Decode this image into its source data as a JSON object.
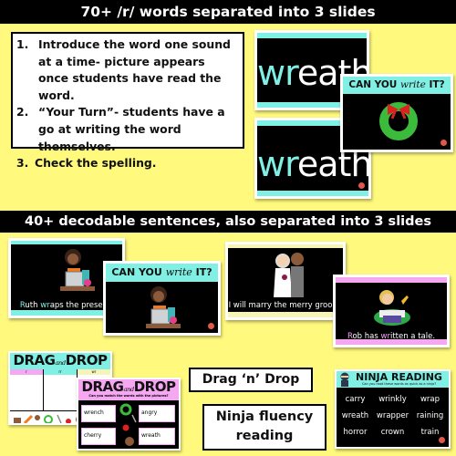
{
  "banners": {
    "top": "70+ /r/ words separated into 3 slides",
    "middle": "40+ decodable sentences, also separated into 3 slides"
  },
  "instructions": [
    {
      "num": "1.",
      "text": "Introduce the word one sound at a time- picture appears once students have read the word."
    },
    {
      "num": "2.",
      "text": "“Your Turn”- students have a go at writing the word themselves."
    },
    {
      "num": "3.",
      "text": "Check the spelling."
    }
  ],
  "word_slides": {
    "word_prefix": "wr",
    "word_suffix": "eath",
    "can_you_write": {
      "pre": "CAN YOU",
      "script": "write",
      "post": "IT?"
    }
  },
  "sentence_slides": {
    "ruth": {
      "hl": "R",
      "mid1": "uth ",
      "hl2": "wr",
      "rest": "aps the present."
    },
    "can_you_write": {
      "pre": "CAN YOU",
      "script": "write",
      "post": "IT?"
    },
    "marry": "I will marry the merry groom.",
    "rob": {
      "hl": "R",
      "mid1": "ob has ",
      "hl2": "wr",
      "rest": "itten a tale."
    }
  },
  "drag_drop": {
    "title_pre": "DRAG",
    "title_and": "and",
    "title_post": "DROP",
    "columns": [
      "r",
      "rr",
      "wr"
    ],
    "subtitle": "Can you match the words with the pictures?",
    "words": [
      "wrench",
      "angry",
      "cherry",
      "wreath"
    ]
  },
  "labels": {
    "drag_n_drop": "Drag ‘n’ Drop",
    "ninja_line1": "Ninja fluency",
    "ninja_line2": "reading"
  },
  "ninja": {
    "title": "NINJA READING",
    "subtitle": "Can you read these words as quick as a ninja?",
    "words": [
      "carry",
      "wrinkly",
      "wrap",
      "wreath",
      "wrapper",
      "raining",
      "horror",
      "crown",
      "train"
    ]
  },
  "colors": {
    "background": "#fff97d",
    "teal": "#7ff0e3",
    "pink": "#f5a7f2",
    "cream": "#f7f4b8",
    "banner": "#000000"
  }
}
